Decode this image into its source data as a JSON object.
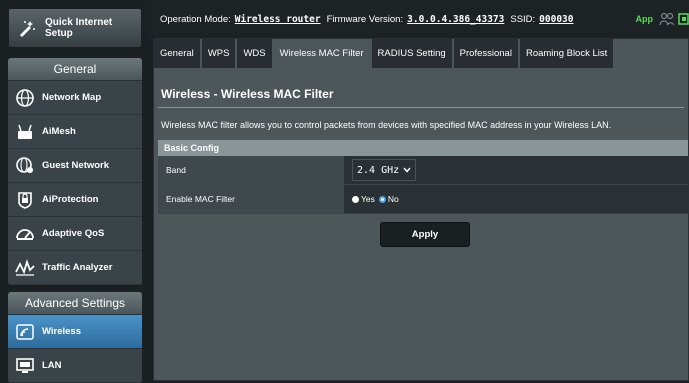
{
  "sidebar": {
    "quick_setup": "Quick Internet Setup",
    "general_header": "General",
    "general_items": [
      {
        "label": "Network Map",
        "icon": "globe-icon"
      },
      {
        "label": "AiMesh",
        "icon": "router-icon"
      },
      {
        "label": "Guest Network",
        "icon": "guest-globe-icon"
      },
      {
        "label": "AiProtection",
        "icon": "lock-icon"
      },
      {
        "label": "Adaptive QoS",
        "icon": "gauge-icon"
      },
      {
        "label": "Traffic Analyzer",
        "icon": "analyzer-icon"
      }
    ],
    "advanced_header": "Advanced Settings",
    "advanced_items": [
      {
        "label": "Wireless",
        "icon": "wifi-icon",
        "active": true
      },
      {
        "label": "LAN",
        "icon": "monitor-icon"
      }
    ]
  },
  "topbar": {
    "op_mode_label": "Operation Mode:",
    "op_mode_value": "Wireless router",
    "fw_label": "Firmware Version:",
    "fw_value": "3.0.0.4.386_43373",
    "ssid_label": "SSID:",
    "ssid_value": "000030",
    "app_label": "App"
  },
  "tabs": [
    "General",
    "WPS",
    "WDS",
    "Wireless MAC Filter",
    "RADIUS Setting",
    "Professional",
    "Roaming Block List"
  ],
  "active_tab": "Wireless MAC Filter",
  "page": {
    "title": "Wireless - Wireless MAC Filter",
    "description": "Wireless MAC filter allows you to control packets from devices with specified MAC address in your Wireless LAN."
  },
  "config": {
    "header": "Basic Config",
    "band_label": "Band",
    "band_value": "2.4 GHz",
    "mac_filter_label": "Enable MAC Filter",
    "yes_label": "Yes",
    "no_label": "No",
    "selected": "No"
  },
  "apply_label": "Apply",
  "colors": {
    "accent": "#2d6c9c",
    "app_green": "#5ad95a",
    "radio_selected": "#4aa3f5"
  }
}
